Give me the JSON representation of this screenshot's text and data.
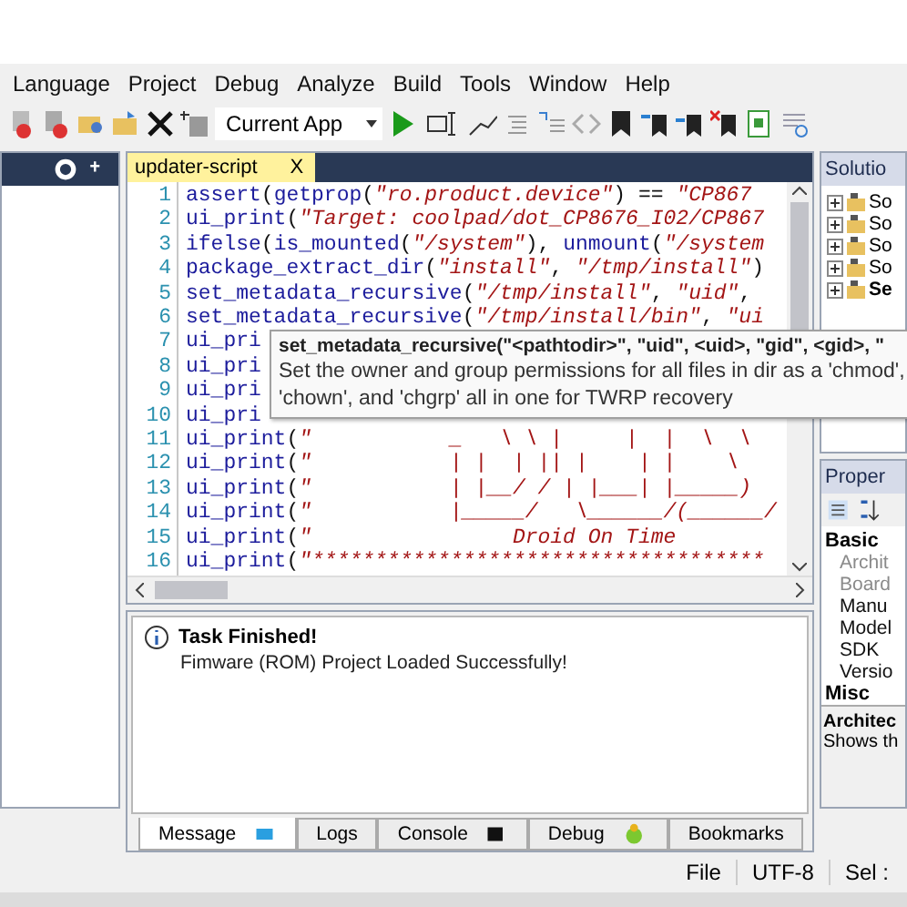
{
  "menu": [
    "Language",
    "Project",
    "Debug",
    "Analyze",
    "Build",
    "Tools",
    "Window",
    "Help"
  ],
  "toolbar": {
    "target": "Current App"
  },
  "editor": {
    "tab": {
      "label": "updater-script",
      "close": "X"
    },
    "lines": [
      {
        "number": "1",
        "text": "assert(getprop(\"ro.product.device\") == \"CP867"
      },
      {
        "number": "2",
        "text": "ui_print(\"Target: coolpad/dot_CP8676_I02/CP867"
      },
      {
        "number": "3",
        "text": "ifelse(is_mounted(\"/system\"), unmount(\"/system"
      },
      {
        "number": "4",
        "text": "package_extract_dir(\"install\", \"/tmp/install\")"
      },
      {
        "number": "5",
        "text": "set_metadata_recursive(\"/tmp/install\", \"uid\","
      },
      {
        "number": "6",
        "text": "set_metadata_recursive(\"/tmp/install/bin\", \"ui"
      },
      {
        "number": "7",
        "text": "ui_pri"
      },
      {
        "number": "8",
        "text": "ui_pri"
      },
      {
        "number": "9",
        "text": "ui_pri"
      },
      {
        "number": "10",
        "text": "ui_pri"
      },
      {
        "number": "11",
        "text": "ui_print(\"           _   \\ \\ |     |  |  \\  \\"
      },
      {
        "number": "12",
        "text": "ui_print(\"           | |  | || |    | |    \\"
      },
      {
        "number": "13",
        "text": "ui_print(\"           | |__/ / | |___| |_____)"
      },
      {
        "number": "14",
        "text": "ui_print(\"           |_____/   \\______/(______/"
      },
      {
        "number": "15",
        "text": "ui_print(\"                Droid On Time"
      },
      {
        "number": "16",
        "text": "ui_print(\"************************************"
      }
    ],
    "tooltip": {
      "signature": "set_metadata_recursive(\"<pathtodir>\", \"uid\", <uid>, \"gid\", <gid>, \"",
      "description": "Set the owner and group permissions for all files in dir as a 'chmod', 'chown', and 'chgrp' all in one for TWRP recovery"
    }
  },
  "messages": {
    "title": "Task Finished!",
    "detail": "Fimware (ROM) Project Loaded Successfully!",
    "tabs": [
      {
        "label": "Message",
        "selected": true,
        "kind": "screen"
      },
      {
        "label": "Logs",
        "selected": false,
        "kind": "plain"
      },
      {
        "label": "Console",
        "selected": false,
        "kind": "console"
      },
      {
        "label": "Debug",
        "selected": false,
        "kind": "bug"
      },
      {
        "label": "Bookmarks",
        "selected": false,
        "kind": "plain"
      }
    ]
  },
  "solution": {
    "title": "Solutio",
    "items": [
      {
        "label": "So",
        "active": false
      },
      {
        "label": "So",
        "active": false
      },
      {
        "label": "So",
        "active": false
      },
      {
        "label": "So",
        "active": false
      },
      {
        "label": "Se",
        "active": true
      }
    ]
  },
  "properties": {
    "title": "Proper",
    "group": "Basic",
    "items": [
      {
        "label": "Archit",
        "disabled": true
      },
      {
        "label": "Board",
        "disabled": true
      },
      {
        "label": "Manu",
        "disabled": false
      },
      {
        "label": "Model",
        "disabled": false
      },
      {
        "label": "SDK",
        "disabled": false
      },
      {
        "label": "Versio",
        "disabled": false
      }
    ],
    "next_group": "Misc",
    "description_title": "Architec",
    "description": "Shows th"
  },
  "status_bar": [
    "File",
    "UTF-8",
    "Sel :"
  ]
}
